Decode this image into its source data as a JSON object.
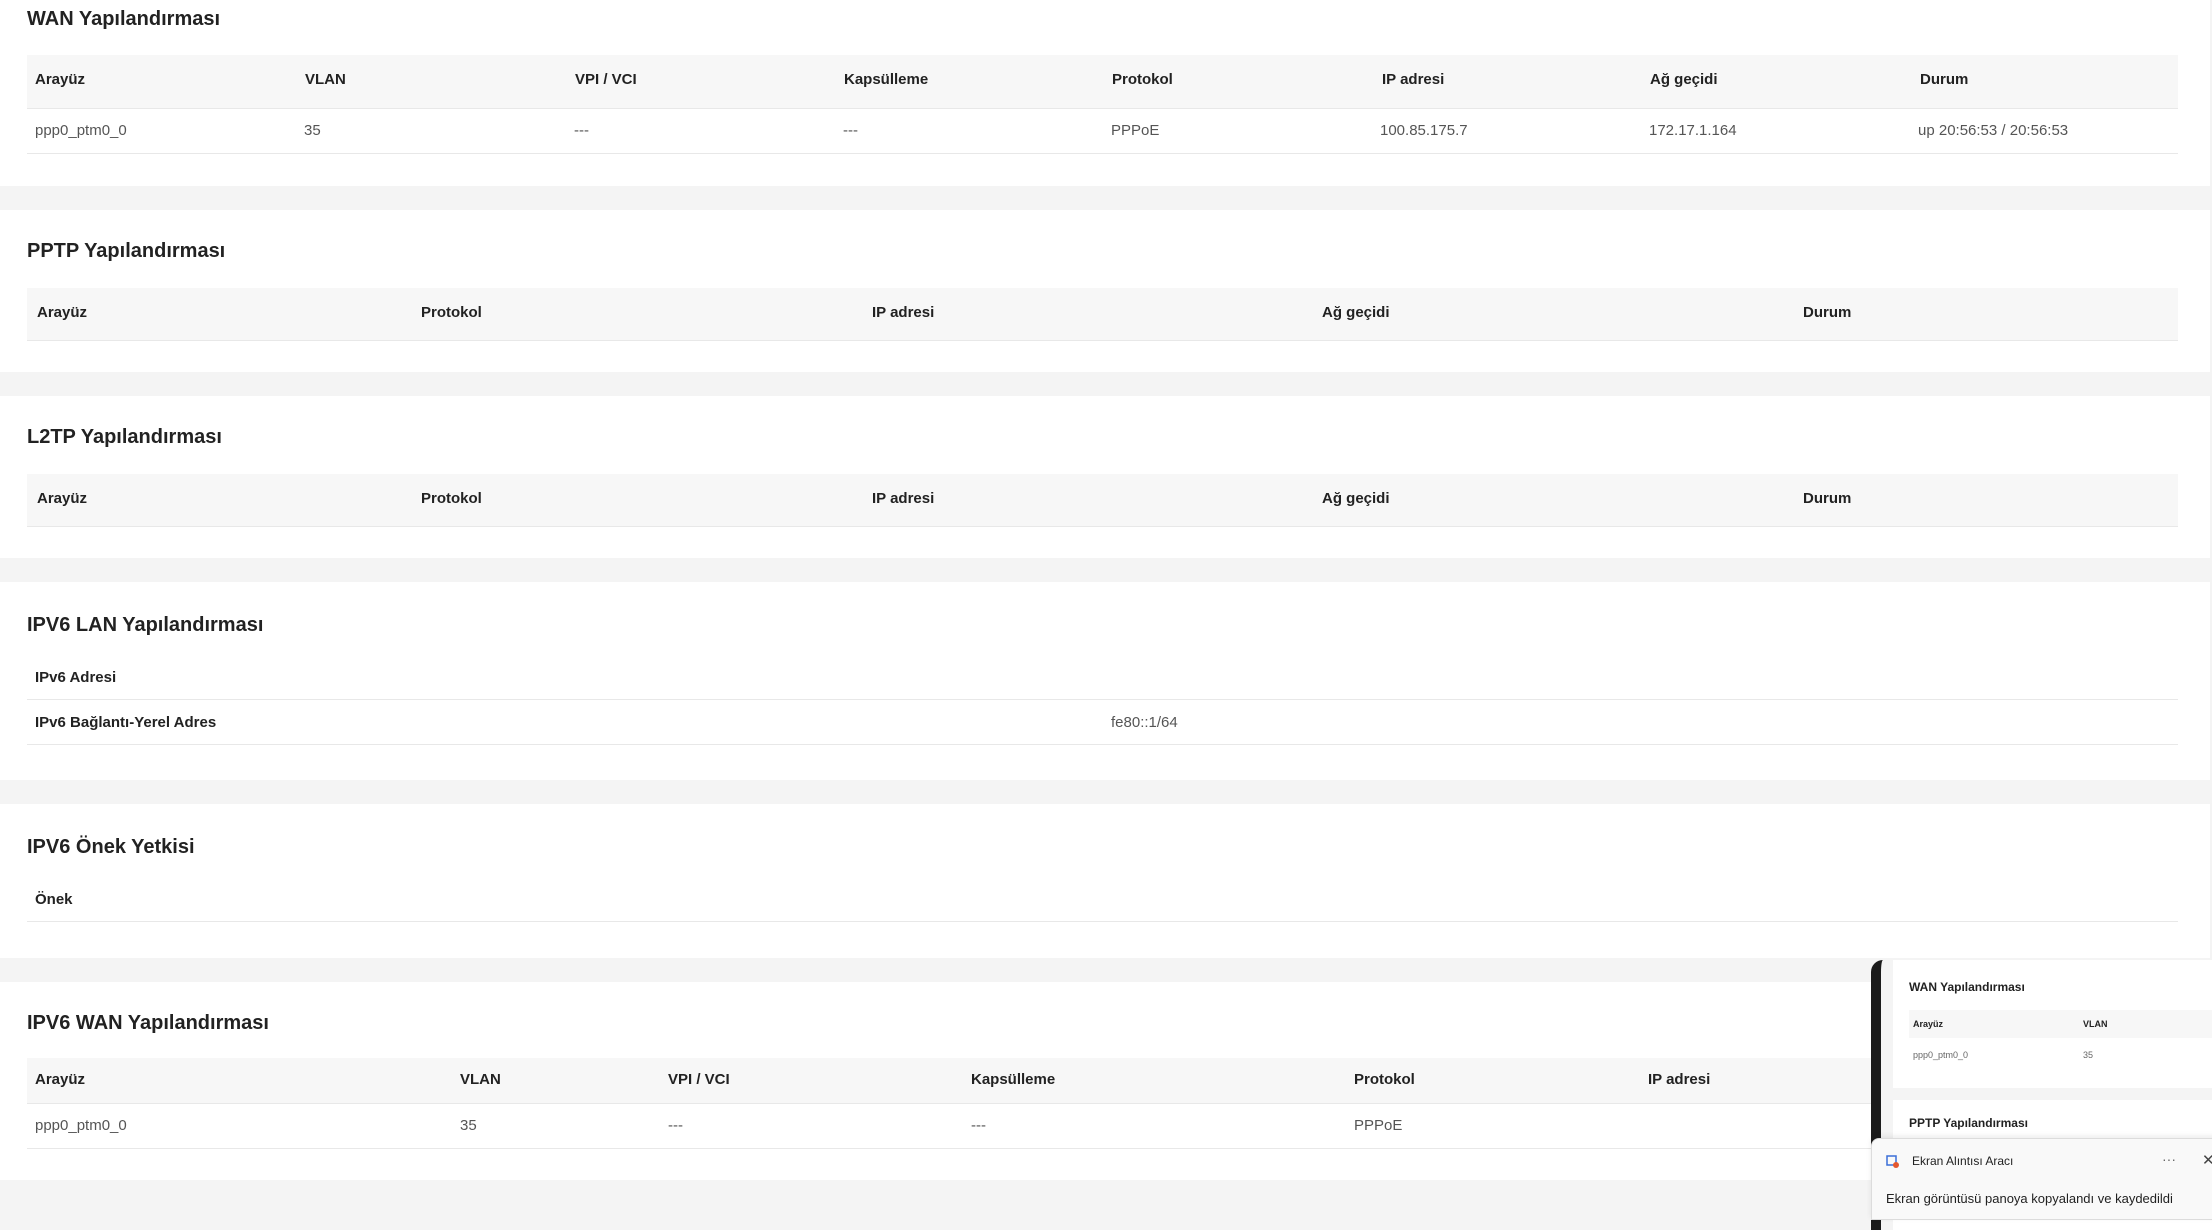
{
  "wan": {
    "title": "WAN Yapılandırması",
    "headers": [
      "Arayüz",
      "VLAN",
      "VPI / VCI",
      "Kapsülleme",
      "Protokol",
      "IP adresi",
      "Ağ geçidi",
      "Durum"
    ],
    "row": [
      "ppp0_ptm0_0",
      "35",
      "---",
      "---",
      "PPPoE",
      "100.85.175.7",
      "172.17.1.164",
      "up 20:56:53 / 20:56:53"
    ]
  },
  "pptp": {
    "title": "PPTP Yapılandırması",
    "headers": [
      "Arayüz",
      "Protokol",
      "IP adresi",
      "Ağ geçidi",
      "Durum"
    ]
  },
  "l2tp": {
    "title": "L2TP Yapılandırması",
    "headers": [
      "Arayüz",
      "Protokol",
      "IP adresi",
      "Ağ geçidi",
      "Durum"
    ]
  },
  "ipv6_lan": {
    "title": "IPV6 LAN Yapılandırması",
    "rows": [
      {
        "label": "IPv6 Adresi",
        "value": ""
      },
      {
        "label": "IPv6 Bağlantı-Yerel Adres",
        "value": "fe80::1/64"
      }
    ]
  },
  "ipv6_prefix": {
    "title": "IPV6 Önek Yetkisi",
    "label": "Önek"
  },
  "ipv6_wan": {
    "title": "IPV6 WAN Yapılandırması",
    "headers": [
      "Arayüz",
      "VLAN",
      "VPI / VCI",
      "Kapsülleme",
      "Protokol",
      "IP adresi"
    ],
    "row": [
      "ppp0_ptm0_0",
      "35",
      "---",
      "---",
      "PPPoE",
      ""
    ]
  },
  "snip_preview": {
    "wan_title": "WAN Yapılandırması",
    "headers": [
      "Arayüz",
      "VLAN"
    ],
    "row": [
      "ppp0_ptm0_0",
      "35"
    ],
    "pptp_title": "PPTP Yapılandırması"
  },
  "toast": {
    "app_name": "Ekran Alıntısı Aracı",
    "more": "···",
    "close": "✕",
    "message": "Ekran görüntüsü panoya kopyalandı ve kaydedildi"
  }
}
